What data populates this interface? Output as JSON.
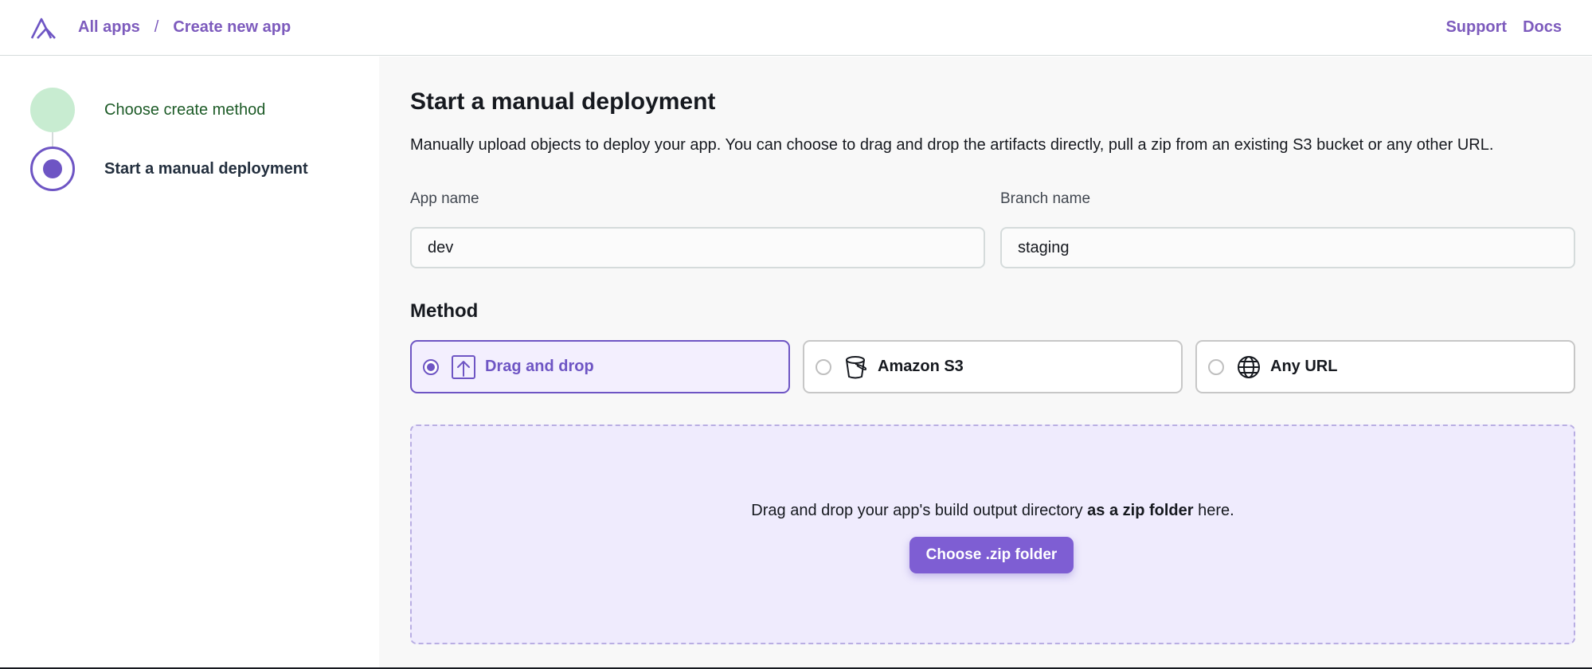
{
  "header": {
    "breadcrumb": [
      "All apps",
      "Create new app"
    ],
    "separator": "/",
    "links": [
      "Support",
      "Docs"
    ]
  },
  "steps": [
    {
      "label": "Choose create method",
      "state": "completed"
    },
    {
      "label": "Start a manual deployment",
      "state": "current"
    }
  ],
  "main": {
    "title": "Start a manual deployment",
    "description": "Manually upload objects to deploy your app. You can choose to drag and drop the artifacts directly, pull a zip from an existing S3 bucket or any other URL.",
    "app_name_label": "App name",
    "app_name_value": "dev",
    "branch_name_label": "Branch name",
    "branch_name_value": "staging",
    "method_title": "Method",
    "methods": [
      {
        "label": "Drag and drop",
        "icon": "upload-icon",
        "selected": true
      },
      {
        "label": "Amazon S3",
        "icon": "bucket-icon",
        "selected": false
      },
      {
        "label": "Any URL",
        "icon": "globe-icon",
        "selected": false
      }
    ],
    "dropzone": {
      "text_before": "Drag and drop your app's build output directory ",
      "text_bold": "as a zip folder",
      "text_after": " here.",
      "button": "Choose .zip folder"
    }
  },
  "colors": {
    "accent": "#6e55c4",
    "link": "#7d5bbd",
    "completed_step": "#c8ecd1",
    "dropzone_bg": "#efebfd"
  }
}
